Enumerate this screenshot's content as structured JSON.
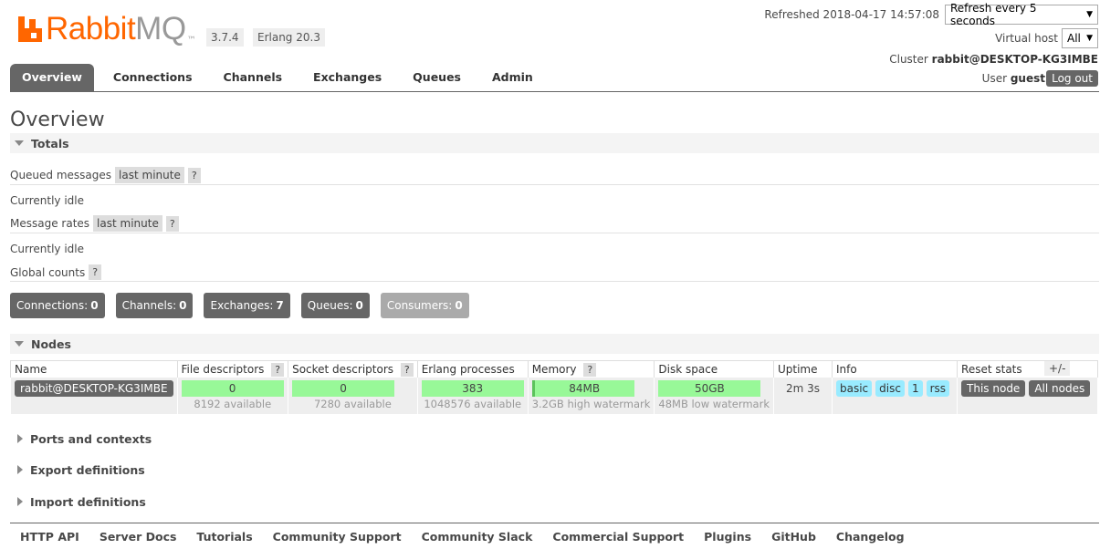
{
  "header": {
    "logo": {
      "rabbit": "Rabbit",
      "mq": "MQ",
      "tm": "™"
    },
    "version": "3.7.4",
    "erlang": "Erlang 20.3",
    "refreshed": "Refreshed 2018-04-17 14:57:08",
    "refresh_select": "Refresh every 5 seconds",
    "vhost_label": "Virtual host",
    "vhost_select": "All",
    "cluster_label": "Cluster",
    "cluster_name": "rabbit@DESKTOP-KG3IMBE",
    "user_label": "User",
    "user_name": "guest",
    "logout": "Log out"
  },
  "tabs": [
    {
      "label": "Overview",
      "active": true
    },
    {
      "label": "Connections"
    },
    {
      "label": "Channels"
    },
    {
      "label": "Exchanges"
    },
    {
      "label": "Queues"
    },
    {
      "label": "Admin"
    }
  ],
  "page_title": "Overview",
  "totals": {
    "title": "Totals",
    "queued_label": "Queued messages",
    "queued_range": "last minute",
    "idle1": "Currently idle",
    "rates_label": "Message rates",
    "rates_range": "last minute",
    "idle2": "Currently idle",
    "global_label": "Global counts",
    "help": "?"
  },
  "counts": [
    {
      "label": "Connections:",
      "value": "0"
    },
    {
      "label": "Channels:",
      "value": "0"
    },
    {
      "label": "Exchanges:",
      "value": "7"
    },
    {
      "label": "Queues:",
      "value": "0"
    },
    {
      "label": "Consumers:",
      "value": "0"
    }
  ],
  "nodes": {
    "title": "Nodes",
    "headers": [
      "Name",
      "File descriptors",
      "Socket descriptors",
      "Erlang processes",
      "Memory",
      "Disk space",
      "Uptime",
      "Info",
      "Reset stats"
    ],
    "row": {
      "name": "rabbit@DESKTOP-KG3IMBE",
      "fd": "0",
      "fd_sub": "8192 available",
      "sd": "0",
      "sd_sub": "7280 available",
      "ep": "383",
      "ep_sub": "1048576 available",
      "mem": "84MB",
      "mem_sub": "3.2GB high watermark",
      "disk": "50GB",
      "disk_sub": "48MB low watermark",
      "uptime": "2m 3s",
      "info": [
        "basic",
        "disc",
        "1",
        "rss"
      ],
      "reset_this": "This node",
      "reset_all": "All nodes"
    },
    "plusminus": "+/-"
  },
  "sections": {
    "ports": "Ports and contexts",
    "export": "Export definitions",
    "import": "Import definitions"
  },
  "footer": [
    "HTTP API",
    "Server Docs",
    "Tutorials",
    "Community Support",
    "Community Slack",
    "Commercial Support",
    "Plugins",
    "GitHub",
    "Changelog"
  ]
}
